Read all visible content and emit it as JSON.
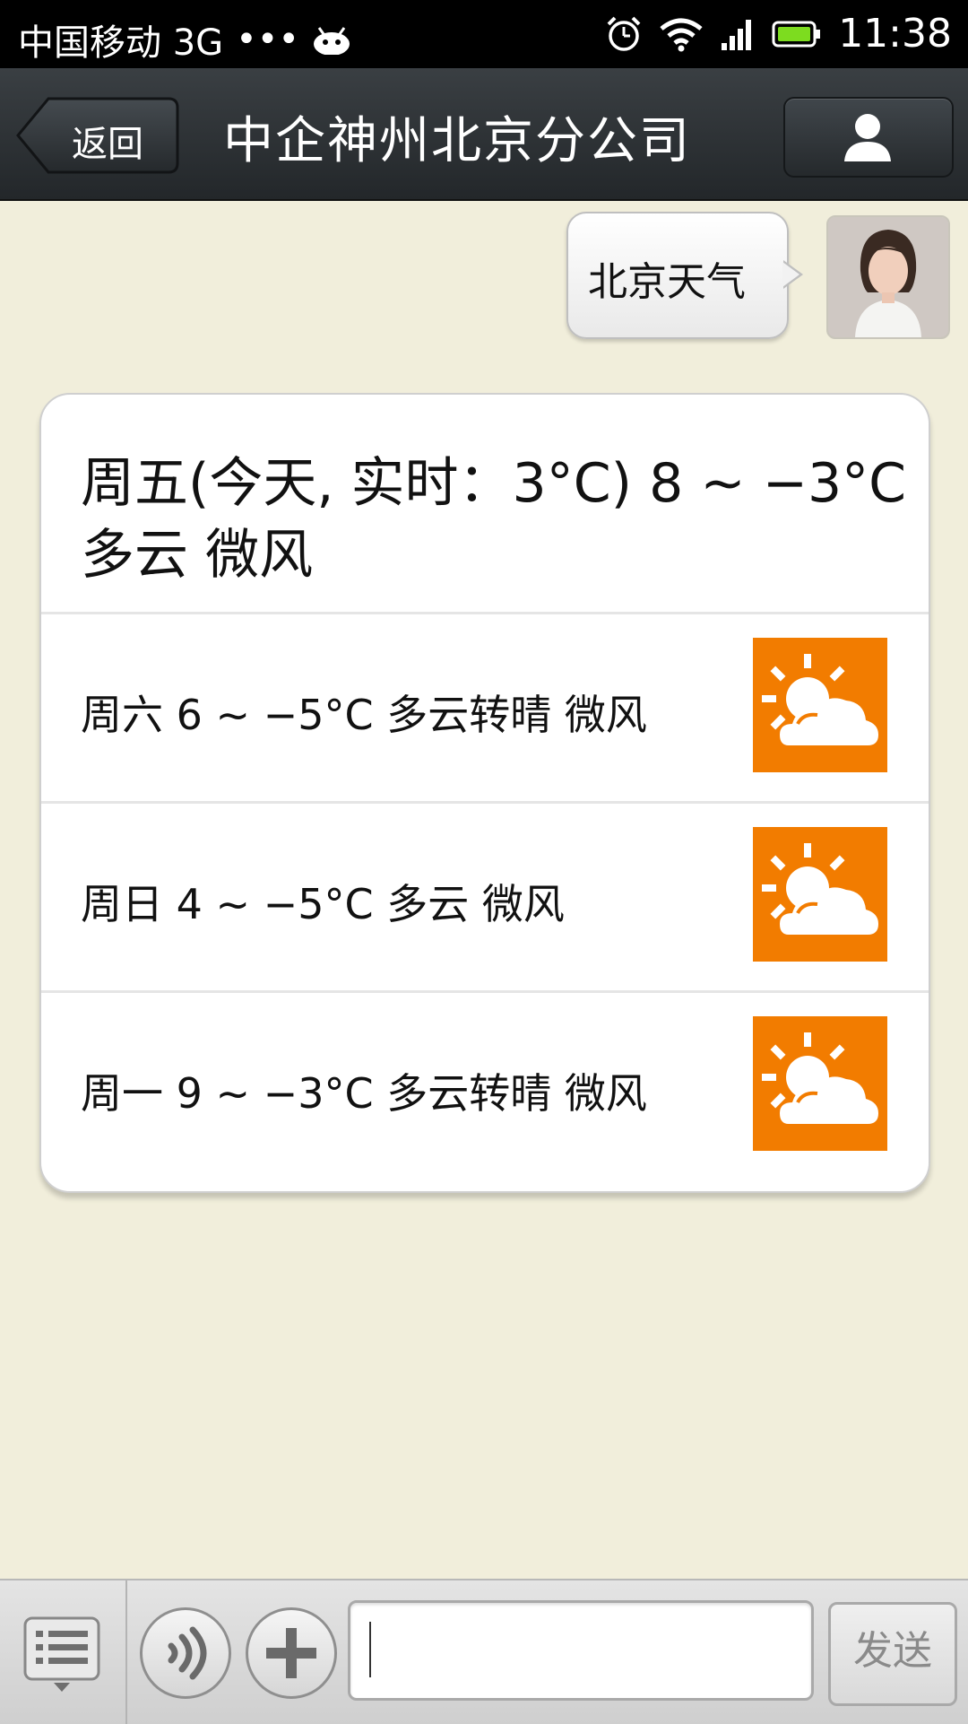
{
  "status_bar": {
    "carrier": "中国移动 3G",
    "dots": "•••",
    "time": "11:38",
    "icons": [
      "android-icon",
      "alarm-icon",
      "wifi-icon",
      "signal-icon",
      "battery-icon"
    ]
  },
  "header": {
    "back_label": "返回",
    "title": "中企神州北京分公司",
    "profile_icon": "person-icon"
  },
  "message": {
    "text": "北京天气",
    "avatar": "user-avatar"
  },
  "weather": {
    "today_line1": "周五(今天, 实时：3°C)  8 ~ −3°C",
    "today_line2": "多云  微风",
    "forecast": [
      {
        "text": "周六  6 ~ −5°C  多云转晴  微风",
        "icon": "partly-cloudy-icon"
      },
      {
        "text": "周日  4 ~ −5°C  多云  微风",
        "icon": "partly-cloudy-icon"
      },
      {
        "text": "周一  9 ~ −3°C  多云转晴  微风",
        "icon": "partly-cloudy-icon"
      }
    ],
    "icon_color": "#f27c00"
  },
  "input_bar": {
    "input_value": "",
    "send_label": "发送"
  },
  "colors": {
    "background": "#f1eedb",
    "header": "#2e3336",
    "accent_orange": "#f27c00"
  }
}
